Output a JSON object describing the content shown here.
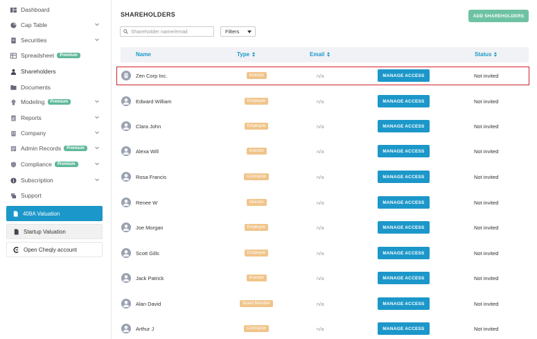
{
  "sidebar": {
    "items": [
      {
        "label": "Dashboard",
        "icon": "dashboard-icon",
        "chevron": false,
        "badge": ""
      },
      {
        "label": "Cap Table",
        "icon": "pie-chart-icon",
        "chevron": true,
        "badge": ""
      },
      {
        "label": "Securities",
        "icon": "document-icon",
        "chevron": true,
        "badge": ""
      },
      {
        "label": "Spreadsheet",
        "icon": "spreadsheet-icon",
        "chevron": false,
        "badge": "Premium"
      },
      {
        "label": "Shareholders",
        "icon": "person-icon",
        "chevron": false,
        "badge": ""
      },
      {
        "label": "Documents",
        "icon": "folder-icon",
        "chevron": false,
        "badge": ""
      },
      {
        "label": "Modeling",
        "icon": "lightbulb-icon",
        "chevron": true,
        "badge": "Premium"
      },
      {
        "label": "Reports",
        "icon": "report-icon",
        "chevron": true,
        "badge": ""
      },
      {
        "label": "Company",
        "icon": "building-icon",
        "chevron": true,
        "badge": ""
      },
      {
        "label": "Admin Records",
        "icon": "records-icon",
        "chevron": true,
        "badge": "Premium"
      },
      {
        "label": "Compliance",
        "icon": "shield-icon",
        "chevron": true,
        "badge": "Premium"
      },
      {
        "label": "Subscription",
        "icon": "info-icon",
        "chevron": true,
        "badge": ""
      },
      {
        "label": "Support",
        "icon": "support-icon",
        "chevron": false,
        "badge": ""
      }
    ],
    "cards": {
      "valuation": "409A Valuation",
      "startup": "Startup Valuation",
      "cheqly": "Open Cheqly account"
    }
  },
  "header": {
    "title": "SHAREHOLDERS",
    "add_button": "ADD SHAREHOLDERS"
  },
  "search": {
    "placeholder": "Shareholder name/email"
  },
  "filters": {
    "label": "Filters"
  },
  "table": {
    "columns": {
      "name": "Name",
      "type": "Type",
      "email": "Email",
      "status": "Status"
    },
    "manage_label": "MANAGE ACCESS",
    "rows": [
      {
        "name": "Zen Corp Inc.",
        "type": "Investor",
        "email": "n/a",
        "status": "Not invited",
        "avatar": "building-icon"
      },
      {
        "name": "Edward William",
        "type": "Employee",
        "email": "n/a",
        "status": "Not invited",
        "avatar": "person-icon"
      },
      {
        "name": "Clara John",
        "type": "Employee",
        "email": "n/a",
        "status": "Not invited",
        "avatar": "person-icon"
      },
      {
        "name": "Alexa Will",
        "type": "Investor",
        "email": "n/a",
        "status": "Not invited",
        "avatar": "person-icon"
      },
      {
        "name": "Rosa Francis",
        "type": "Contractor",
        "email": "n/a",
        "status": "Not invited",
        "avatar": "person-icon"
      },
      {
        "name": "Renee W",
        "type": "Director",
        "email": "n/a",
        "status": "Not invited",
        "avatar": "person-icon"
      },
      {
        "name": "Joe Morgan",
        "type": "Employee",
        "email": "n/a",
        "status": "Not invited",
        "avatar": "person-icon"
      },
      {
        "name": "Scott Gills",
        "type": "Employee",
        "email": "n/a",
        "status": "Not invited",
        "avatar": "person-icon"
      },
      {
        "name": "Jack Patrick",
        "type": "Investor",
        "email": "n/a",
        "status": "Not invited",
        "avatar": "person-icon"
      },
      {
        "name": "Alan David",
        "type": "Board Member",
        "email": "n/a",
        "status": "Not invited",
        "avatar": "person-icon"
      },
      {
        "name": "Arthur J",
        "type": "Contractor",
        "email": "n/a",
        "status": "Not invited",
        "avatar": "person-icon"
      }
    ]
  },
  "colors": {
    "accent": "#1c97c9",
    "add_button": "#6ec2a4",
    "premium_badge": "#5fb89a",
    "type_badge": "#f0c48a",
    "highlight": "#d1202a"
  }
}
